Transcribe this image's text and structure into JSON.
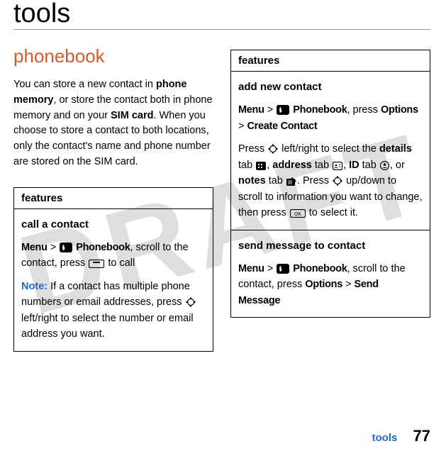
{
  "watermark": "DRAFT",
  "page": {
    "title": "tools",
    "section": "phonebook",
    "intro_parts": [
      "You can store a new contact in ",
      "phone memory",
      ", or store the contact both in phone memory and on your ",
      "SIM card",
      ". When you choose to store a contact to both locations, only the contact's name and phone number are stored on the SIM card."
    ]
  },
  "left_table": {
    "header": "features",
    "row_title": "call a contact",
    "menu": "Menu",
    "gt": ">",
    "phonebook": "Phonebook",
    "step1_after": ", scroll to the contact, press ",
    "step1_end": " to call",
    "note_label": "Note:",
    "note_body": " If a contact has multiple phone numbers or email addresses, press ",
    "note_end": " left/right to select the number or email address you want."
  },
  "right_table": {
    "header": "features",
    "row1": {
      "title": "add new contact",
      "menu": "Menu",
      "gt": ">",
      "phonebook": "Phonebook",
      "after_pb": ", press ",
      "options": "Options",
      "gt2": ">",
      "create": "Create Contact",
      "press": "Press ",
      "lr": " left/right to select the ",
      "details": "details",
      "tab1": " tab ",
      "comma": ", ",
      "address": "address",
      "id": "ID",
      "or": ", or ",
      "notes": "notes",
      "period": ". Press ",
      "updown": " up/down to scroll to information you want to change, then press ",
      "end": " to select it."
    },
    "row2": {
      "title": "send message to contact",
      "menu": "Menu",
      "gt": ">",
      "phonebook": "Phonebook",
      "after": ", scroll to the contact, press ",
      "options": "Options",
      "gt2": ">",
      "send": "Send Message"
    }
  },
  "footer": {
    "label": "tools",
    "page": "77"
  }
}
